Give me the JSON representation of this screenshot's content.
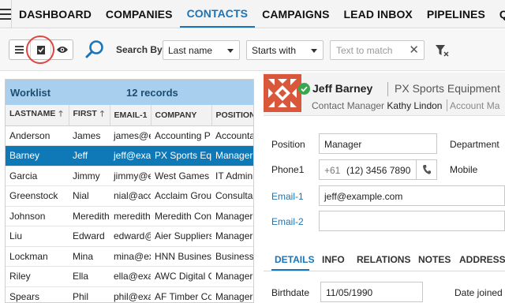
{
  "nav": {
    "items": [
      "DASHBOARD",
      "COMPANIES",
      "CONTACTS",
      "CAMPAIGNS",
      "LEAD INBOX",
      "PIPELINES",
      "QUOTE"
    ],
    "active": "CONTACTS"
  },
  "toolbar": {
    "view_icons": [
      "list-icon",
      "card-icon",
      "eye-icon"
    ],
    "search_by_label": "Search By",
    "field_select": "Last name",
    "operator_select": "Starts with",
    "text_placeholder": "Text to match"
  },
  "worklist": {
    "title": "Worklist",
    "count": "12 records",
    "columns": [
      "LASTNAME",
      "FIRST",
      "EMAIL-1",
      "COMPANY",
      "POSITION"
    ],
    "selected_index": 1,
    "rows": [
      [
        "Anderson",
        "James",
        "james@e",
        "Accounting P",
        "Accounta"
      ],
      [
        "Barney",
        "Jeff",
        "jeff@exa",
        "PX Sports Equ",
        "Manager"
      ],
      [
        "Garcia",
        "Jimmy",
        "jimmy@e",
        "West Games I",
        "IT Admini"
      ],
      [
        "Greenstock",
        "Nial",
        "nial@acc",
        "Acclaim Grou",
        "Consultar"
      ],
      [
        "Johnson",
        "Meredith",
        "meredith",
        "Meredith Con",
        "Manager"
      ],
      [
        "Liu",
        "Edward",
        "edward@",
        "Aier Suppliers",
        "Manager"
      ],
      [
        "Lockman",
        "Mina",
        "mina@ex",
        "HNN Business",
        "Business C"
      ],
      [
        "Riley",
        "Ella",
        "ella@exa",
        "AWC Digital C",
        "Manager"
      ],
      [
        "Spears",
        "Phil",
        "phil@exa",
        "AF Timber Co",
        "Manager"
      ]
    ]
  },
  "detail": {
    "name": "Jeff Barney",
    "company": "PX Sports Equipment",
    "role_label": "Contact Manager",
    "role_value": "Kathy Lindon",
    "role2_label": "Account Ma",
    "position_label": "Position",
    "position_value": "Manager",
    "department_label": "Department",
    "phone1_label": "Phone1",
    "phone_cc": "+61",
    "phone_number": "(12) 3456 7890",
    "mobile_label": "Mobile",
    "email1_label": "Email-1",
    "email1_value": "jeff@example.com",
    "email2_label": "Email-2",
    "email2_value": "",
    "tabs": [
      "DETAILS",
      "INFO",
      "RELATIONS",
      "NOTES",
      "ADDRESS"
    ],
    "active_tab": "DETAILS",
    "birthdate_label": "Birthdate",
    "birthdate_value": "11/05/1990",
    "date_joined_label": "Date joined"
  },
  "colors": {
    "accent": "#1a75b8",
    "selection": "#0f79b8",
    "worklist_header": "#a8d0ee",
    "logo": "#d9573a",
    "status_ok": "#34a84a",
    "highlight_circle": "#e0443f"
  }
}
